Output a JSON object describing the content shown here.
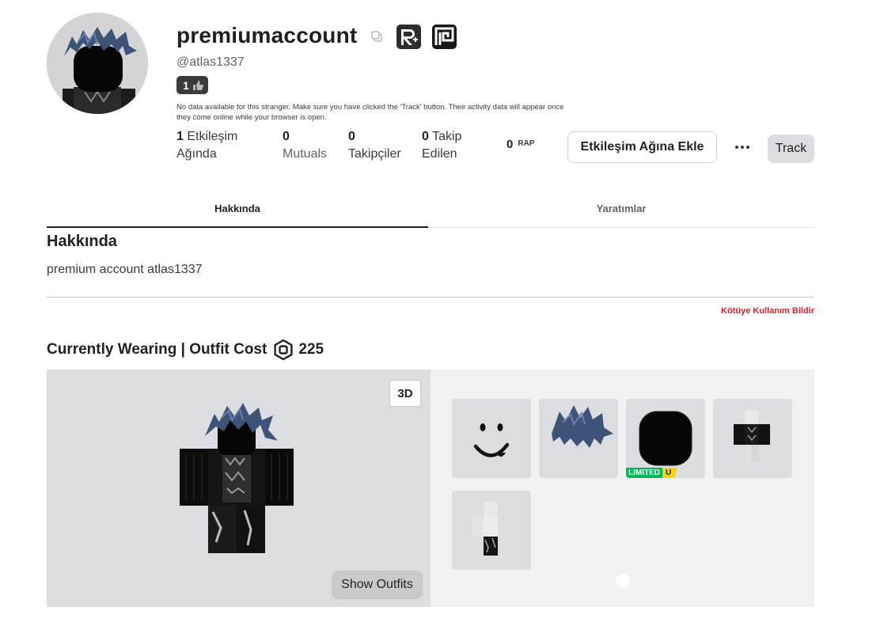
{
  "profile": {
    "display_name": "premiumaccount",
    "handle": "@atlas1337",
    "likes": "1",
    "notice": "No data available for this stranger. Make sure you have clicked the 'Track' button. Their activity data will appear once they come online while your browser is open."
  },
  "stats": {
    "friends_value": "1",
    "friends_label_1": "Etkileşim",
    "friends_label_2": "Ağında",
    "mutuals_value": "0",
    "mutuals_label": "Mutuals",
    "followers_value": "0",
    "followers_label": "Takipçiler",
    "following_value": "0",
    "following_label_1": "Takip",
    "following_label_2": "Edilen",
    "rap_value": "0",
    "rap_label": "RAP"
  },
  "actions": {
    "add_friend": "Etkileşim Ağına Ekle",
    "track": "Track"
  },
  "tabs": [
    "Hakkında",
    "Yaratımlar"
  ],
  "about": {
    "title": "Hakkında",
    "text": "premium account atlas1337",
    "report": "Kötüye Kullanım Bildir"
  },
  "wearing": {
    "title": "Currently Wearing | Outfit Cost",
    "cost": "225",
    "view_3d": "3D",
    "show_outfits": "Show Outfits",
    "limited_label": "LIMITED",
    "limited_u": "U"
  },
  "colors": {
    "accent_report": "#d3262b",
    "limited_green": "#02b757",
    "limited_yellow": "#f6d514"
  }
}
